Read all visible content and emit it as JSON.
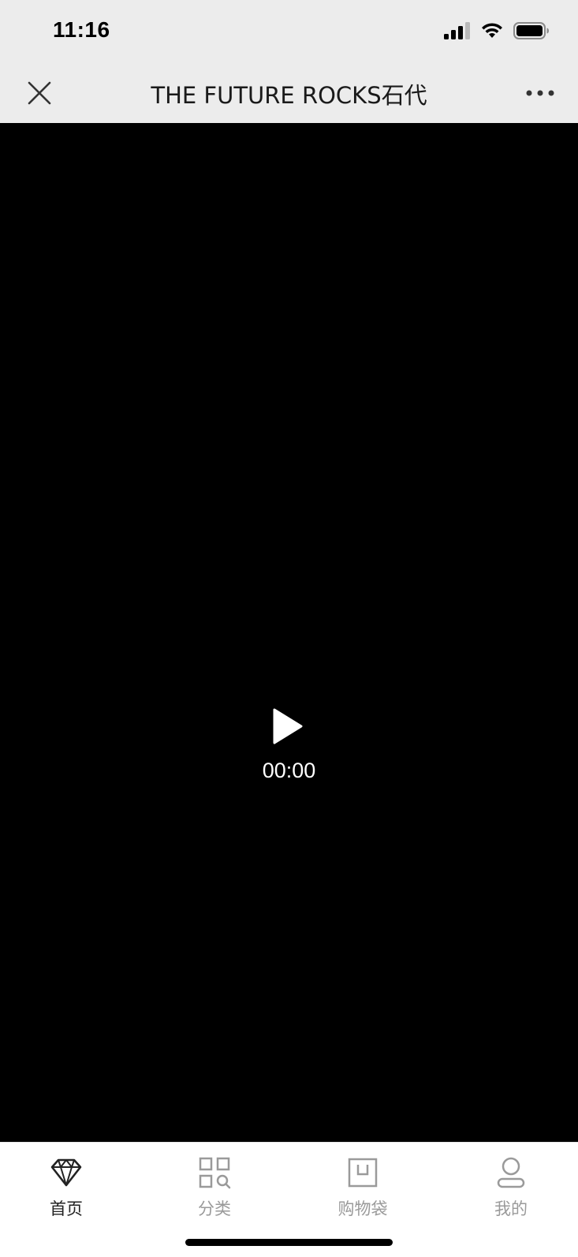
{
  "status_bar": {
    "time": "11:16",
    "icons": [
      "cellular-signal-icon",
      "wifi-icon",
      "battery-icon"
    ]
  },
  "nav_bar": {
    "title": "THE FUTURE ROCKS石代",
    "close_icon": "close-icon",
    "more_icon": "more-horizontal-icon"
  },
  "video": {
    "current_time": "00:00",
    "play_icon": "play-icon",
    "background_color": "#000000"
  },
  "tab_bar": {
    "tabs": [
      {
        "label": "首页",
        "icon": "diamond-icon",
        "active": true
      },
      {
        "label": "分类",
        "icon": "category-grid-icon",
        "active": false
      },
      {
        "label": "购物袋",
        "icon": "shopping-bag-icon",
        "active": false
      },
      {
        "label": "我的",
        "icon": "profile-icon",
        "active": false
      }
    ]
  },
  "colors": {
    "header_bg": "#ececec",
    "active_tab": "#222222",
    "inactive_tab": "#9a9a9a"
  }
}
